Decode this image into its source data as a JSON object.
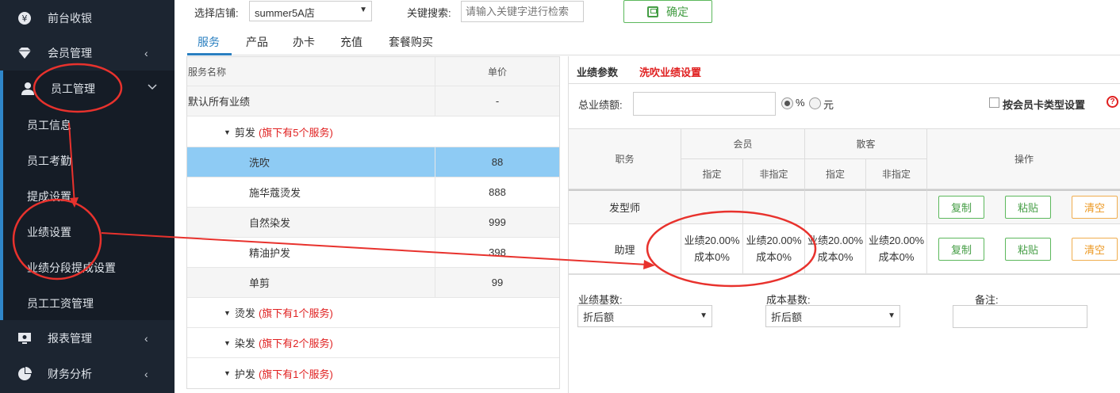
{
  "sidebar": {
    "items": [
      {
        "label": "前台收银",
        "icon": "yen-icon"
      },
      {
        "label": "会员管理",
        "icon": "diamond-icon",
        "chevron": "‹"
      },
      {
        "label": "员工管理",
        "icon": "user-icon",
        "chevron": "⌄"
      },
      {
        "label": "报表管理",
        "icon": "monitor-icon",
        "chevron": "‹"
      },
      {
        "label": "财务分析",
        "icon": "pie-chart-icon",
        "chevron": "‹"
      }
    ],
    "sub_items": [
      "员工信息",
      "员工考勤",
      "提成设置",
      "业绩设置",
      "业绩分段提成设置",
      "员工工资管理"
    ]
  },
  "toolbar": {
    "store_label": "选择店铺:",
    "store_value": "summer5A店",
    "search_label": "关键搜索:",
    "search_placeholder": "请输入关键字进行检索",
    "confirm_label": "确定"
  },
  "tabs": [
    "服务",
    "产品",
    "办卡",
    "充值",
    "套餐购买"
  ],
  "service_table": {
    "headers": [
      "服务名称",
      "单价"
    ],
    "default_row": {
      "name": "默认所有业绩",
      "price": "-"
    },
    "groups": [
      {
        "name": "剪发",
        "note": "(旗下有5个服务)"
      },
      {
        "name": "烫发",
        "note": "(旗下有1个服务)"
      },
      {
        "name": "染发",
        "note": "(旗下有2个服务)"
      },
      {
        "name": "护发",
        "note": "(旗下有1个服务)"
      }
    ],
    "services": [
      {
        "name": "洗吹",
        "price": "88"
      },
      {
        "name": "施华蔻烫发",
        "price": "888"
      },
      {
        "name": "自然染发",
        "price": "999"
      },
      {
        "name": "精油护发",
        "price": "398"
      },
      {
        "name": "单剪",
        "price": "99"
      }
    ]
  },
  "panel": {
    "title": "业绩参数",
    "subtitle": "洗吹业绩设置",
    "total_label": "总业绩额:",
    "unit_percent": "%",
    "unit_yuan": "元",
    "by_card_label": "按会员卡类型设置",
    "help": "?",
    "grid": {
      "role_header": "职务",
      "member_header": "会员",
      "guest_header": "散客",
      "assigned": "指定",
      "not_assigned": "非指定",
      "ops_header": "操作",
      "rows": [
        {
          "role": "发型师"
        },
        {
          "role": "助理",
          "perf": "业绩20.00%",
          "cost": "成本0%"
        }
      ],
      "copy": "复制",
      "paste": "粘贴",
      "clear": "清空"
    },
    "perf_base_label": "业绩基数:",
    "perf_base_value": "折后额",
    "cost_base_label": "成本基数:",
    "cost_base_value": "折后额",
    "note_label": "备注:"
  },
  "colors": {
    "sidebar_bg": "#1c2531",
    "accent": "#2a7fc0",
    "danger": "#e02020",
    "success": "#449d44",
    "warning": "#ec971f"
  }
}
